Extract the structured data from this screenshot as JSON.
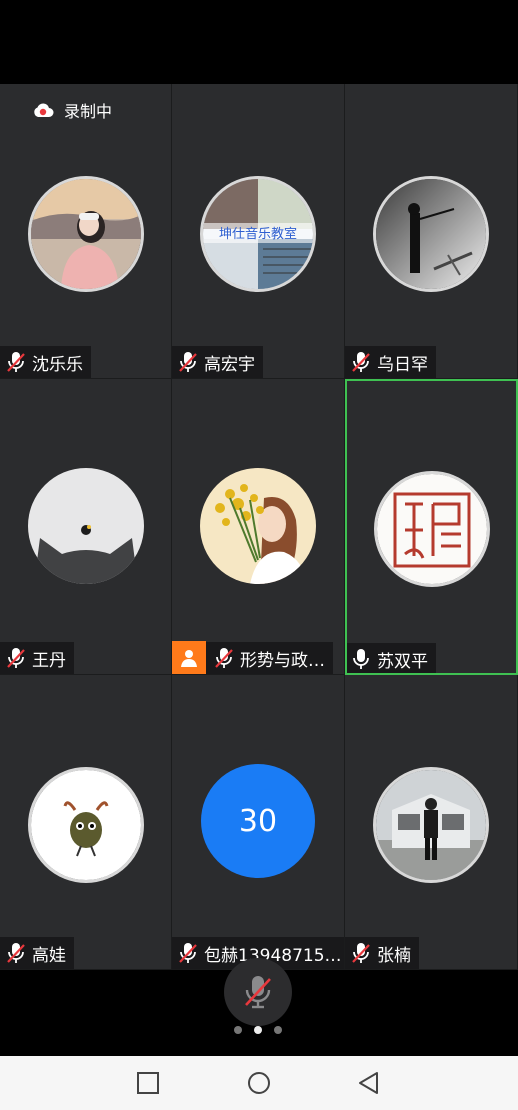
{
  "recording": {
    "label": "录制中",
    "icon": "cloud-record-icon",
    "color": "#e8383d"
  },
  "participants": [
    {
      "name": "沈乐乐",
      "mic": "muted"
    },
    {
      "name": "高宏宇",
      "mic": "muted",
      "avatar_text": "坤仕音乐教室"
    },
    {
      "name": "乌日罕",
      "mic": "muted"
    },
    {
      "name": "王丹",
      "mic": "muted"
    },
    {
      "name": "形势与政…",
      "mic": "muted",
      "host": true
    },
    {
      "name": "苏双平",
      "mic": "active",
      "speaking": true
    },
    {
      "name": "高娃",
      "mic": "muted"
    },
    {
      "name": "包赫13948715…",
      "mic": "muted",
      "avatar_number": "30"
    },
    {
      "name": "张楠",
      "mic": "muted"
    }
  ],
  "toolbar": {
    "mic_state": "muted"
  },
  "pager": {
    "total": 3,
    "current": 2
  },
  "colors": {
    "accent_blue": "#1a7cf5",
    "active_border": "#3fc152",
    "host_badge": "#ff7a1a",
    "mute_red": "#e8383d"
  },
  "nav": {
    "icons": [
      "recent-apps-icon",
      "home-icon",
      "back-icon"
    ]
  }
}
